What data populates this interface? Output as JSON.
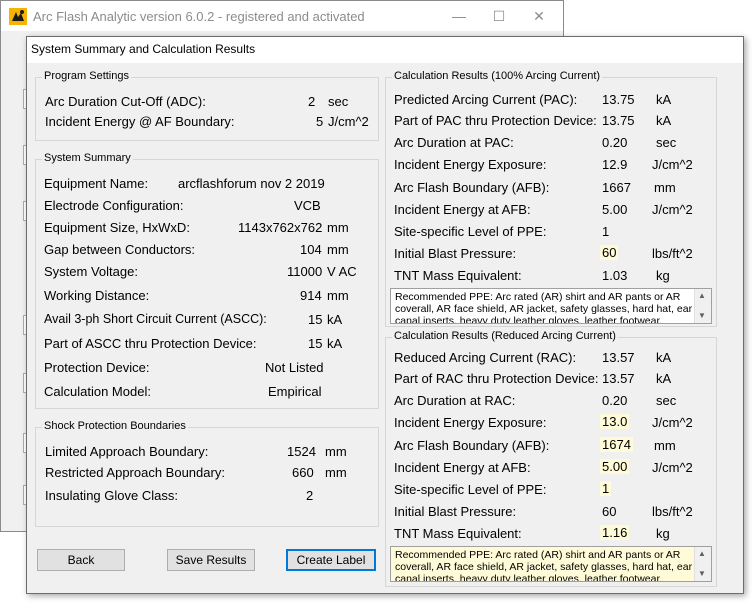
{
  "parent_window": {
    "title": "Arc Flash Analytic version 6.0.2 - registered and activated",
    "minimize": "—",
    "maximize": "☐",
    "close": "✕"
  },
  "dialog": {
    "title": "System Summary and Calculation Results"
  },
  "program_settings": {
    "title": "Program Settings",
    "rows": [
      {
        "label": "Arc Duration Cut-Off (ADC):",
        "value": "2",
        "unit": "sec"
      },
      {
        "label": "Incident Energy @ AF Boundary:",
        "value": "5",
        "unit": "J/cm^2"
      }
    ]
  },
  "system_summary": {
    "title": "System Summary",
    "rows": [
      {
        "label": "Equipment Name:",
        "value": "arcflashforum nov 2 2019"
      },
      {
        "label": "Electrode Configuration:",
        "value": "VCB"
      },
      {
        "label": "Equipment Size, HxWxD:",
        "value": "1143x762x762",
        "unit": "mm"
      },
      {
        "label": "Gap between Conductors:",
        "value": "104",
        "unit": "mm"
      },
      {
        "label": "System Voltage:",
        "value": "11000",
        "unit": "V AC"
      },
      {
        "label": "Working Distance:",
        "value": "914",
        "unit": "mm"
      },
      {
        "label": "Avail 3-ph Short Circuit Current (ASCC):",
        "value": "15",
        "unit": "kA"
      },
      {
        "label": "Part of ASCC thru Protection Device:",
        "value": "15",
        "unit": "kA"
      },
      {
        "label": "Protection Device:",
        "value": "Not Listed"
      },
      {
        "label": "Calculation Model:",
        "value": "Empirical"
      }
    ]
  },
  "shock_protection": {
    "title": "Shock Protection Boundaries",
    "rows": [
      {
        "label": "Limited Approach Boundary:",
        "value": "1524",
        "unit": "mm"
      },
      {
        "label": "Restricted Approach Boundary:",
        "value": "660",
        "unit": "mm"
      },
      {
        "label": "Insulating Glove Class:",
        "value": "2"
      }
    ]
  },
  "results_100": {
    "title": "Calculation Results (100% Arcing Current)",
    "rows": [
      {
        "label": "Predicted Arcing Current (PAC):",
        "value": "13.75",
        "unit": "kA"
      },
      {
        "label": "Part of PAC thru Protection Device:",
        "value": "13.75",
        "unit": "kA"
      },
      {
        "label": "Arc Duration at PAC:",
        "value": "0.20",
        "unit": "sec"
      },
      {
        "label": "Incident Energy Exposure:",
        "value": "12.9",
        "unit": "J/cm^2"
      },
      {
        "label": "Arc Flash Boundary (AFB):",
        "value": "1667",
        "unit": "mm"
      },
      {
        "label": "Incident Energy at AFB:",
        "value": "5.00",
        "unit": "J/cm^2"
      },
      {
        "label": "Site-specific Level of PPE:",
        "value": "1"
      },
      {
        "label": "Initial Blast Pressure:",
        "value": "60",
        "unit": "lbs/ft^2"
      },
      {
        "label": "TNT Mass Equivalent:",
        "value": "1.03",
        "unit": "kg"
      }
    ],
    "ppe": "Recommended PPE: Arc rated (AR) shirt and AR pants or AR coverall, AR face shield, AR jacket, safety glasses, hard hat, ear canal inserts, heavy duty leather gloves, leather footwear."
  },
  "results_reduced": {
    "title": "Calculation Results (Reduced  Arcing Current)",
    "rows": [
      {
        "label": "Reduced Arcing Current (RAC):",
        "value": "13.57",
        "unit": "kA"
      },
      {
        "label": "Part of RAC thru Protection Device:",
        "value": "13.57",
        "unit": "kA"
      },
      {
        "label": "Arc Duration at RAC:",
        "value": "0.20",
        "unit": "sec"
      },
      {
        "label": "Incident Energy Exposure:",
        "value": "13.0",
        "unit": "J/cm^2"
      },
      {
        "label": "Arc Flash Boundary (AFB):",
        "value": "1674",
        "unit": "mm"
      },
      {
        "label": "Incident Energy at AFB:",
        "value": "5.00",
        "unit": "J/cm^2"
      },
      {
        "label": "Site-specific Level of PPE:",
        "value": "1"
      },
      {
        "label": "Initial Blast Pressure:",
        "value": "60",
        "unit": "lbs/ft^2"
      },
      {
        "label": "TNT Mass Equivalent:",
        "value": "1.16",
        "unit": "kg"
      }
    ],
    "ppe": "Recommended PPE: Arc rated (AR) shirt and AR pants or AR coverall, AR face shield, AR jacket, safety glasses, hard hat, ear canal inserts, heavy duty leather gloves, leather footwear."
  },
  "buttons": {
    "back": "Back",
    "save": "Save Results",
    "create_label": "Create Label"
  },
  "colors": {
    "highlight": "#fffbd8",
    "accent": "#0078d7"
  }
}
